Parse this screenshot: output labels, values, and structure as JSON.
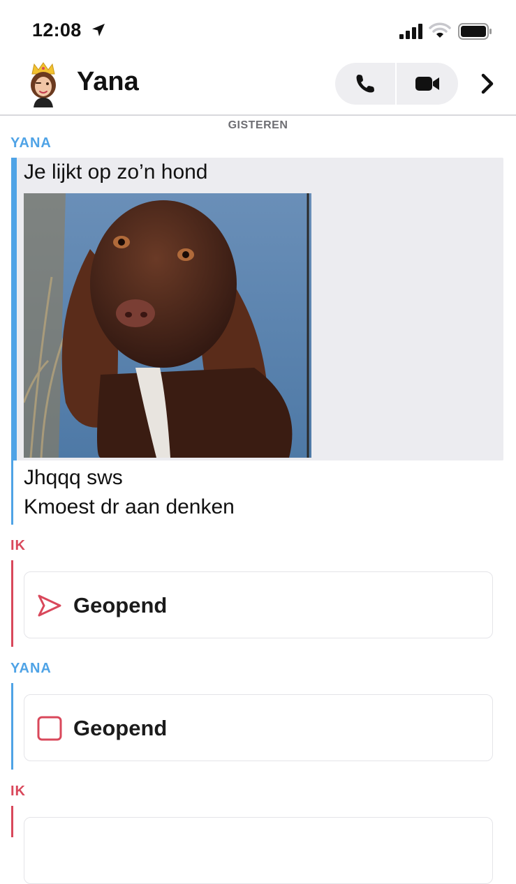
{
  "status_bar": {
    "time": "12:08",
    "icons": [
      "location-arrow-icon",
      "signal-icon",
      "wifi-icon",
      "battery-icon"
    ]
  },
  "header": {
    "contact_name": "Yana",
    "avatar": "bitmoji-avatar",
    "buttons": [
      "phone-icon",
      "video-icon",
      "chevron-right-icon"
    ]
  },
  "chat": {
    "date_divider": "GISTEREN",
    "messages": [
      {
        "sender": "YANA",
        "text": "Je lijkt op zo’n hond",
        "image": "brown-spaniel-photo"
      },
      {
        "sender": "YANA",
        "text": "Jhqqq sws"
      },
      {
        "sender": "YANA",
        "text": "Kmoest dr aan denken"
      },
      {
        "sender": "IK",
        "status": "Geopend",
        "icon": "sent-arrow-icon"
      },
      {
        "sender": "YANA",
        "status": "Geopend",
        "icon": "received-square-icon"
      },
      {
        "sender": "IK"
      }
    ]
  },
  "colors": {
    "yana": "#4fa3e6",
    "ik": "#d9485b",
    "quoted_bg": "#ececf0",
    "call_button_bg": "#eeeef1"
  }
}
